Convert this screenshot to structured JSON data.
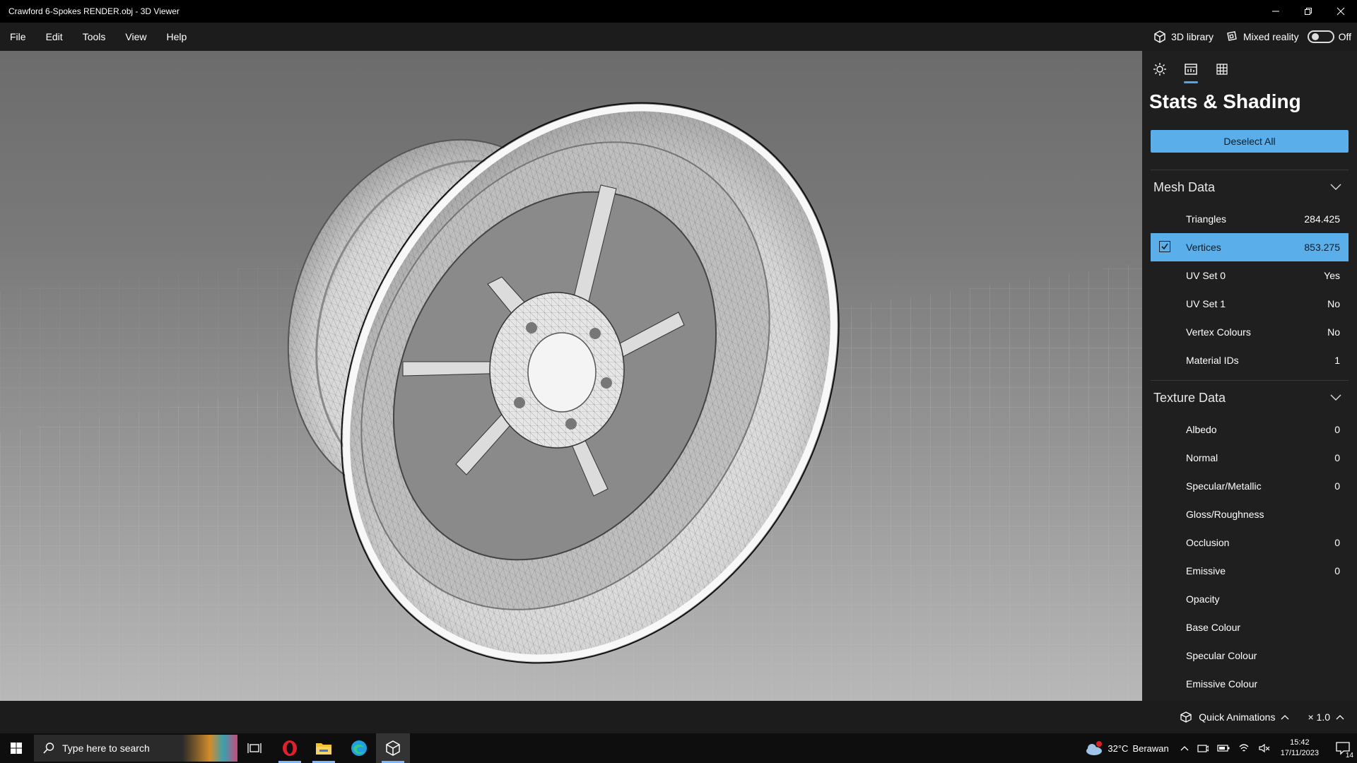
{
  "window": {
    "title": "Crawford 6-Spokes RENDER.obj - 3D Viewer",
    "controls": [
      "minimize-icon",
      "restore-icon",
      "close-icon"
    ]
  },
  "menu": {
    "items": [
      "File",
      "Edit",
      "Tools",
      "View",
      "Help"
    ],
    "library_label": "3D library",
    "mixed_reality_label": "Mixed reality",
    "mixed_reality_state": "Off"
  },
  "panel": {
    "title": "Stats & Shading",
    "deselect_label": "Deselect All",
    "tabs": [
      "lighting-icon",
      "stats-icon",
      "grid-icon"
    ],
    "active_tab": "stats-icon",
    "mesh": {
      "label": "Mesh Data",
      "rows": [
        {
          "label": "Triangles",
          "value": "284.425"
        },
        {
          "label": "Vertices",
          "value": "853.275"
        },
        {
          "label": "UV Set 0",
          "value": "Yes"
        },
        {
          "label": "UV Set 1",
          "value": "No"
        },
        {
          "label": "Vertex Colours",
          "value": "No"
        },
        {
          "label": "Material IDs",
          "value": "1"
        }
      ],
      "selected_row": "Vertices"
    },
    "texture": {
      "label": "Texture Data",
      "rows": [
        {
          "label": "Albedo",
          "value": "0"
        },
        {
          "label": "Normal",
          "value": "0"
        },
        {
          "label": "Specular/Metallic",
          "value": "0"
        },
        {
          "label": "Gloss/Roughness",
          "value": ""
        },
        {
          "label": "Occlusion",
          "value": "0"
        },
        {
          "label": "Emissive",
          "value": "0"
        },
        {
          "label": "Opacity",
          "value": ""
        },
        {
          "label": "Base Colour",
          "value": ""
        },
        {
          "label": "Specular Colour",
          "value": ""
        },
        {
          "label": "Emissive Colour",
          "value": ""
        }
      ]
    }
  },
  "bottombar": {
    "quick_animations": "Quick Animations",
    "speed": "× 1.0"
  },
  "taskbar": {
    "search_placeholder": "Type here to search",
    "weather_temp": "32°C",
    "weather_text": "Berawan",
    "time": "15:42",
    "date": "17/11/2023",
    "notification_count": "14"
  },
  "colors": {
    "accent": "#5aaeea",
    "panel_bg": "#1f1f1f",
    "menubar_bg": "#1c1c1c"
  }
}
